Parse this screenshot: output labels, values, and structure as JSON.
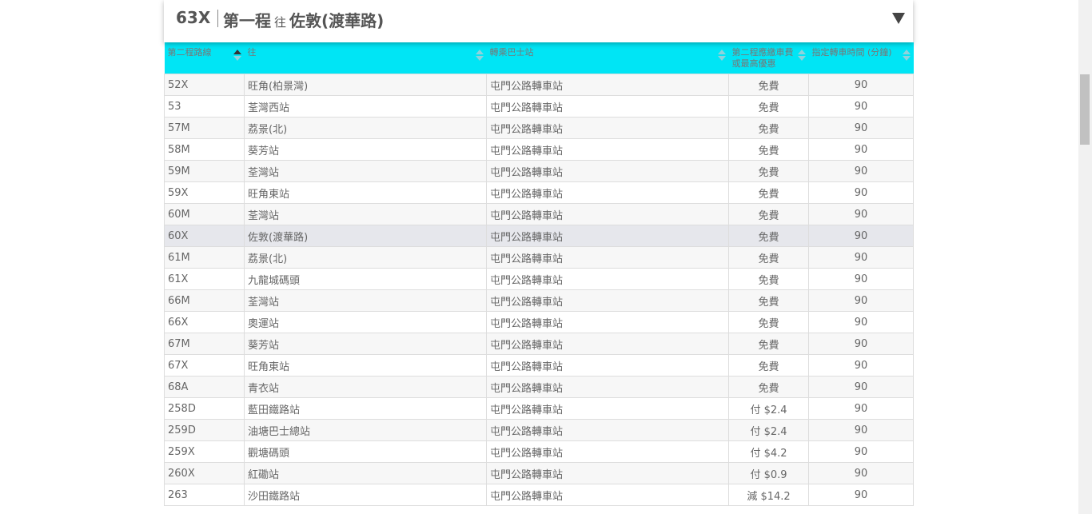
{
  "header": {
    "route_no": "63X",
    "direction_prefix": "第一程",
    "direction_word": "往",
    "destination": "佐敦(渡華路)"
  },
  "table": {
    "columns": [
      {
        "label": "第二程路線",
        "sorted": "asc"
      },
      {
        "label": "往",
        "sorted": ""
      },
      {
        "label": "轉乘巴士站",
        "sorted": ""
      },
      {
        "label": "第二程應繳車費或最高優惠",
        "sorted": ""
      },
      {
        "label": "指定轉車時間 (分鐘)",
        "sorted": ""
      }
    ],
    "rows": [
      {
        "route": "52X",
        "dest": "旺角(柏景灣)",
        "stop": "屯門公路轉車站",
        "fare": "免費",
        "time": "90"
      },
      {
        "route": "53",
        "dest": "荃灣西站",
        "stop": "屯門公路轉車站",
        "fare": "免費",
        "time": "90"
      },
      {
        "route": "57M",
        "dest": "荔景(北)",
        "stop": "屯門公路轉車站",
        "fare": "免費",
        "time": "90"
      },
      {
        "route": "58M",
        "dest": "葵芳站",
        "stop": "屯門公路轉車站",
        "fare": "免費",
        "time": "90"
      },
      {
        "route": "59M",
        "dest": "荃灣站",
        "stop": "屯門公路轉車站",
        "fare": "免費",
        "time": "90"
      },
      {
        "route": "59X",
        "dest": "旺角東站",
        "stop": "屯門公路轉車站",
        "fare": "免費",
        "time": "90"
      },
      {
        "route": "60M",
        "dest": "荃灣站",
        "stop": "屯門公路轉車站",
        "fare": "免費",
        "time": "90"
      },
      {
        "route": "60X",
        "dest": "佐敦(渡華路)",
        "stop": "屯門公路轉車站",
        "fare": "免費",
        "time": "90",
        "highlight": true
      },
      {
        "route": "61M",
        "dest": "荔景(北)",
        "stop": "屯門公路轉車站",
        "fare": "免費",
        "time": "90"
      },
      {
        "route": "61X",
        "dest": "九龍城碼頭",
        "stop": "屯門公路轉車站",
        "fare": "免費",
        "time": "90"
      },
      {
        "route": "66M",
        "dest": "荃灣站",
        "stop": "屯門公路轉車站",
        "fare": "免費",
        "time": "90"
      },
      {
        "route": "66X",
        "dest": "奧運站",
        "stop": "屯門公路轉車站",
        "fare": "免費",
        "time": "90"
      },
      {
        "route": "67M",
        "dest": "葵芳站",
        "stop": "屯門公路轉車站",
        "fare": "免費",
        "time": "90"
      },
      {
        "route": "67X",
        "dest": "旺角東站",
        "stop": "屯門公路轉車站",
        "fare": "免費",
        "time": "90"
      },
      {
        "route": "68A",
        "dest": "青衣站",
        "stop": "屯門公路轉車站",
        "fare": "免費",
        "time": "90"
      },
      {
        "route": "258D",
        "dest": "藍田鐵路站",
        "stop": "屯門公路轉車站",
        "fare": "付 $2.4",
        "time": "90"
      },
      {
        "route": "259D",
        "dest": "油塘巴士總站",
        "stop": "屯門公路轉車站",
        "fare": "付 $2.4",
        "time": "90"
      },
      {
        "route": "259X",
        "dest": "觀塘碼頭",
        "stop": "屯門公路轉車站",
        "fare": "付 $4.2",
        "time": "90"
      },
      {
        "route": "260X",
        "dest": "紅磡站",
        "stop": "屯門公路轉車站",
        "fare": "付 $0.9",
        "time": "90"
      },
      {
        "route": "263",
        "dest": "沙田鐵路站",
        "stop": "屯門公路轉車站",
        "fare": "減 $14.2",
        "time": "90"
      }
    ]
  }
}
